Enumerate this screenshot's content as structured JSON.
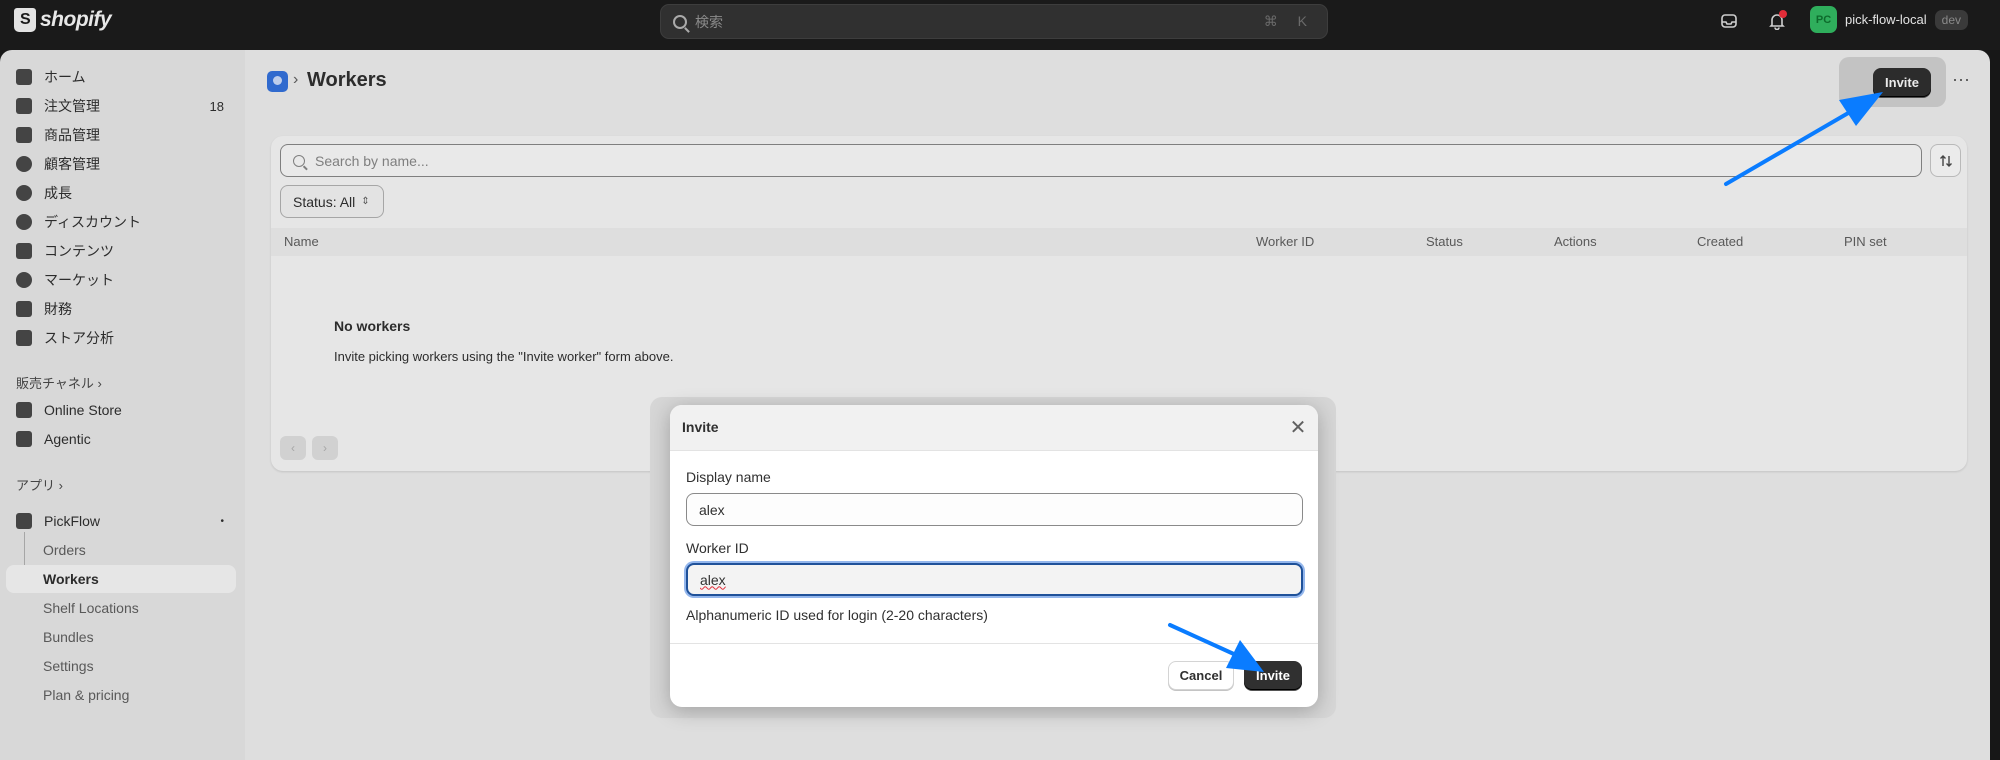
{
  "topbar": {
    "brand": "shopify",
    "search_placeholder": "検索",
    "search_shortcut": "⌘ K",
    "notification_count": "1",
    "store_initials": "PC",
    "store_name": "pick-flow-local",
    "store_tag": "dev"
  },
  "sidebar": {
    "items": [
      {
        "label": "ホーム",
        "icon": "home-icon"
      },
      {
        "label": "注文管理",
        "icon": "inbox-icon",
        "badge": "18"
      },
      {
        "label": "商品管理",
        "icon": "tag-icon"
      },
      {
        "label": "顧客管理",
        "icon": "person-icon"
      },
      {
        "label": "成長",
        "icon": "gauge-icon"
      },
      {
        "label": "ディスカウント",
        "icon": "discount-icon"
      },
      {
        "label": "コンテンツ",
        "icon": "content-icon"
      },
      {
        "label": "マーケット",
        "icon": "globe-icon"
      },
      {
        "label": "財務",
        "icon": "bank-icon"
      },
      {
        "label": "ストア分析",
        "icon": "chart-icon"
      }
    ],
    "sales_channels_label": "販売チャネル",
    "channels": [
      {
        "label": "Online Store",
        "icon": "store-icon"
      },
      {
        "label": "Agentic",
        "icon": "agentic-icon"
      }
    ],
    "apps_label": "アプリ",
    "app": {
      "label": "PickFlow",
      "icon": "pickflow-icon"
    },
    "app_subitems": [
      "Orders",
      "Workers",
      "Shelf Locations",
      "Bundles",
      "Settings",
      "Plan & pricing"
    ],
    "active_subitem": "Workers"
  },
  "page": {
    "title": "Workers",
    "invite_button": "Invite",
    "more_actions": "⋯",
    "search_placeholder": "Search by name...",
    "status_filter": "Status: All",
    "columns": [
      "Name",
      "Worker ID",
      "Status",
      "Actions",
      "Created",
      "PIN set"
    ],
    "empty_title": "No workers",
    "empty_description": "Invite picking workers using the \"Invite worker\" form above."
  },
  "modal": {
    "title": "Invite",
    "display_name_label": "Display name",
    "display_name_value": "alex",
    "worker_id_label": "Worker ID",
    "worker_id_value": "alex",
    "worker_id_help": "Alphanumeric ID used for login (2-20 characters)",
    "cancel_button": "Cancel",
    "invite_button": "Invite"
  },
  "colors": {
    "annotation_arrow": "#0a7cff",
    "topbar_bg": "#1a1a1a",
    "primary_button": "#303030"
  }
}
